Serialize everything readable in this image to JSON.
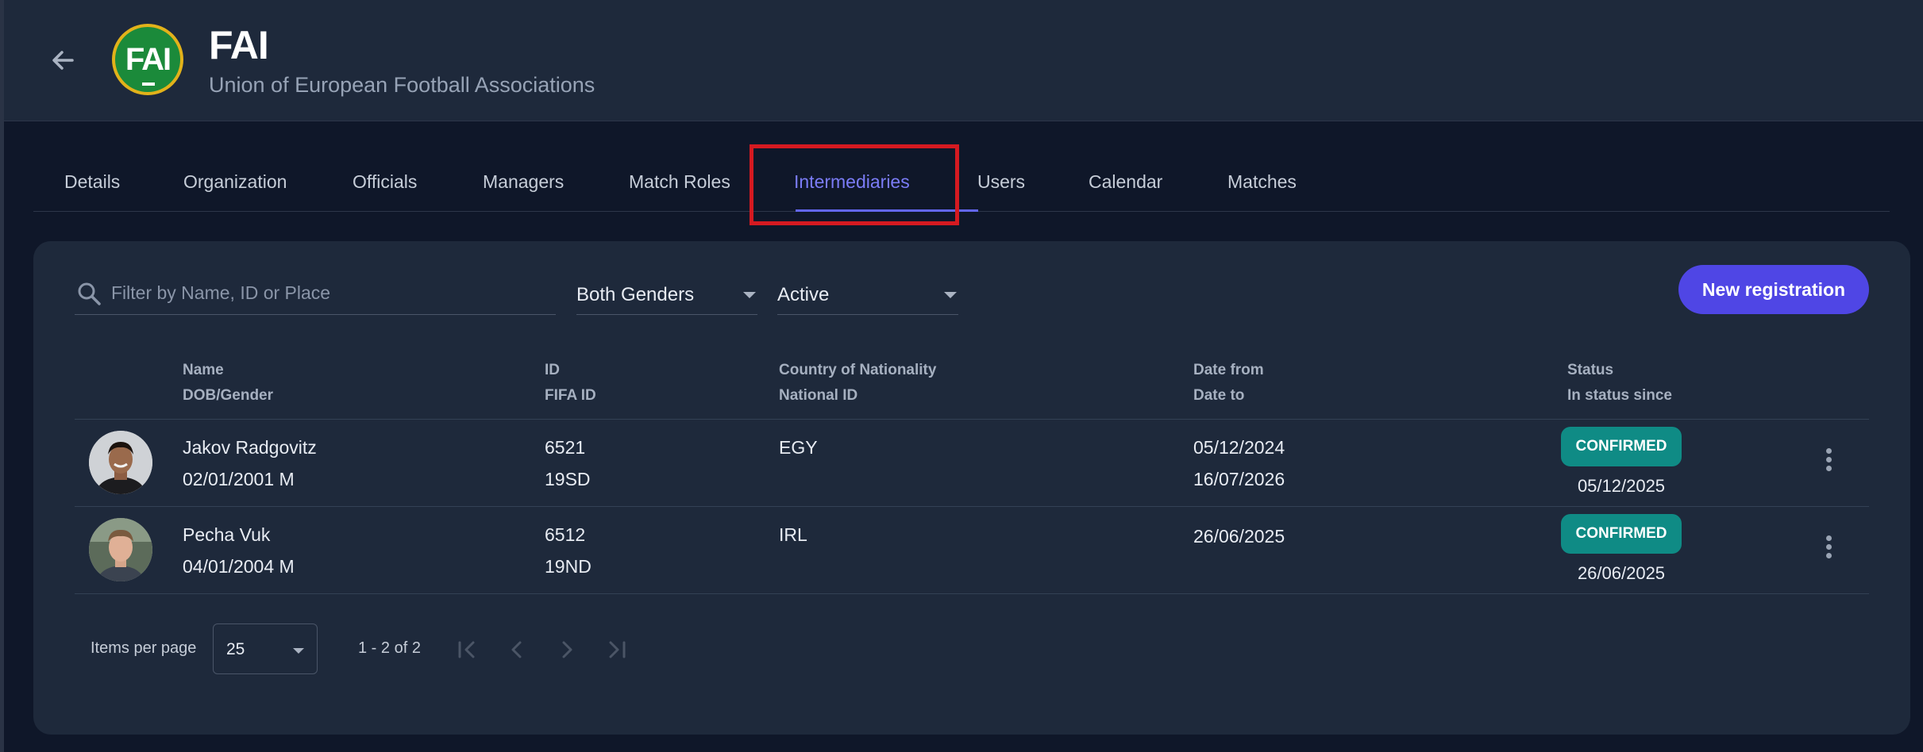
{
  "header": {
    "title": "FAI",
    "subtitle": "Union of European Football Associations",
    "logo_text": "FAI"
  },
  "tabs": [
    {
      "label": "Details",
      "active": false
    },
    {
      "label": "Organization",
      "active": false
    },
    {
      "label": "Officials",
      "active": false
    },
    {
      "label": "Managers",
      "active": false
    },
    {
      "label": "Match Roles",
      "active": false
    },
    {
      "label": "Intermediaries",
      "active": true
    },
    {
      "label": "Users",
      "active": false
    },
    {
      "label": "Calendar",
      "active": false
    },
    {
      "label": "Matches",
      "active": false
    }
  ],
  "filters": {
    "search_placeholder": "Filter by Name, ID or Place",
    "gender": "Both Genders",
    "status": "Active",
    "new_button": "New registration"
  },
  "columns": {
    "name": "Name",
    "dob_gender": "DOB/Gender",
    "id": "ID",
    "fifa_id": "FIFA ID",
    "country": "Country of Nationality",
    "national_id": "National ID",
    "date_from": "Date from",
    "date_to": "Date to",
    "status": "Status",
    "status_since": "In status since"
  },
  "rows": [
    {
      "name": "Jakov Radgovitz",
      "dob_gender": "02/01/2001 M",
      "id": "6521",
      "fifa_id": "19SD",
      "country": "EGY",
      "national_id": "",
      "date_from": "05/12/2024",
      "date_to": "16/07/2026",
      "status": "CONFIRMED",
      "status_since": "05/12/2025"
    },
    {
      "name": "Pecha Vuk",
      "dob_gender": "04/01/2004 M",
      "id": "6512",
      "fifa_id": "19ND",
      "country": "IRL",
      "national_id": "",
      "date_from": "26/06/2025",
      "date_to": "",
      "status": "CONFIRMED",
      "status_since": "26/06/2025"
    }
  ],
  "pagination": {
    "items_per_page_label": "Items per page",
    "items_per_page": "25",
    "range": "1 - 2 of 2"
  },
  "colors": {
    "accent": "#4f46e5",
    "active_tab": "#7b7cf7",
    "confirmed_badge": "#0f8b85",
    "highlight": "#d51a21"
  },
  "icons": {
    "back": "arrow-left-icon",
    "search": "search-icon",
    "menu": "more-vertical-icon"
  }
}
